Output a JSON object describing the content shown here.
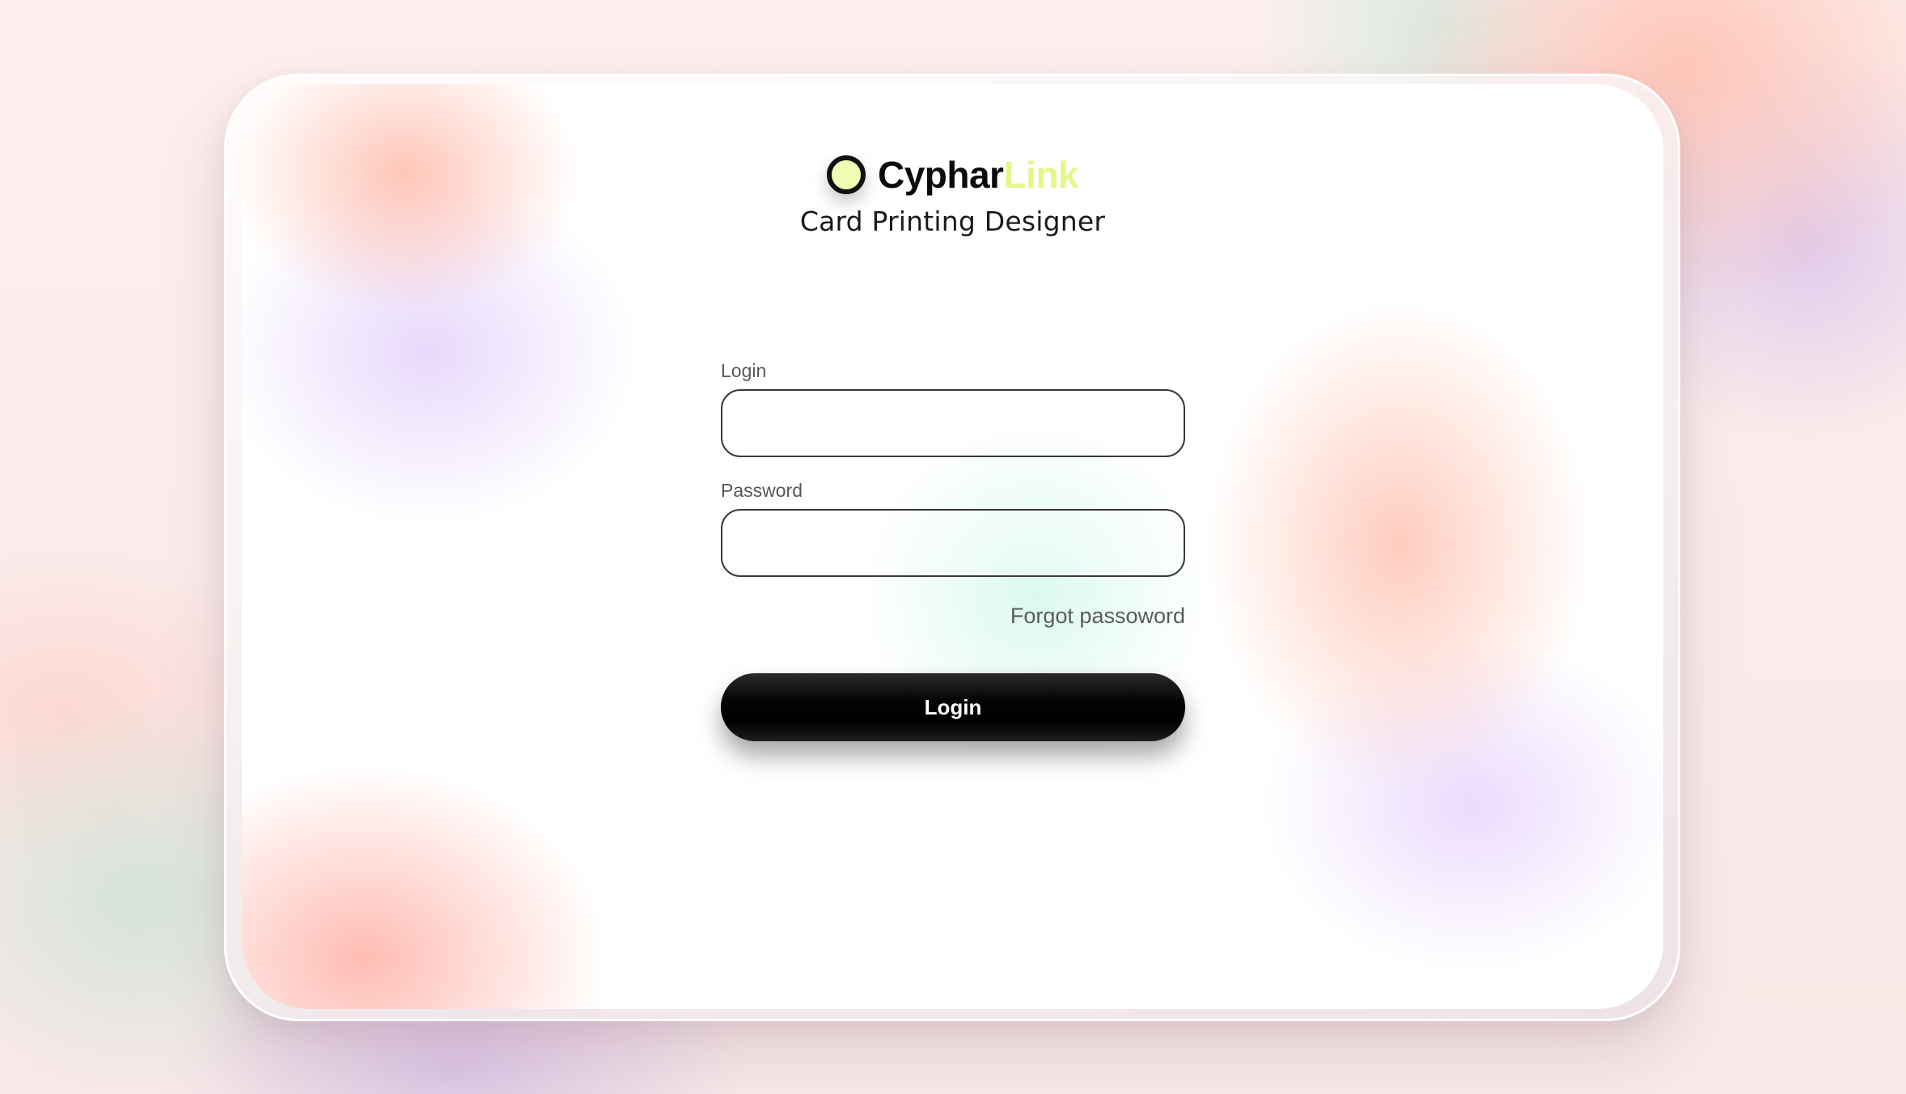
{
  "brand": {
    "name_part1": "Cyphar",
    "name_part2": "Link",
    "subtitle": "Card Printing Designer",
    "logo_icon": "ring-logo-icon"
  },
  "form": {
    "login_label": "Login",
    "login_value": "",
    "password_label": "Password",
    "password_value": "",
    "forgot_link": "Forgot passoword",
    "submit_label": "Login"
  },
  "colors": {
    "accent": "#e3f78a",
    "text": "#0b0b0b",
    "button": "#000000"
  }
}
